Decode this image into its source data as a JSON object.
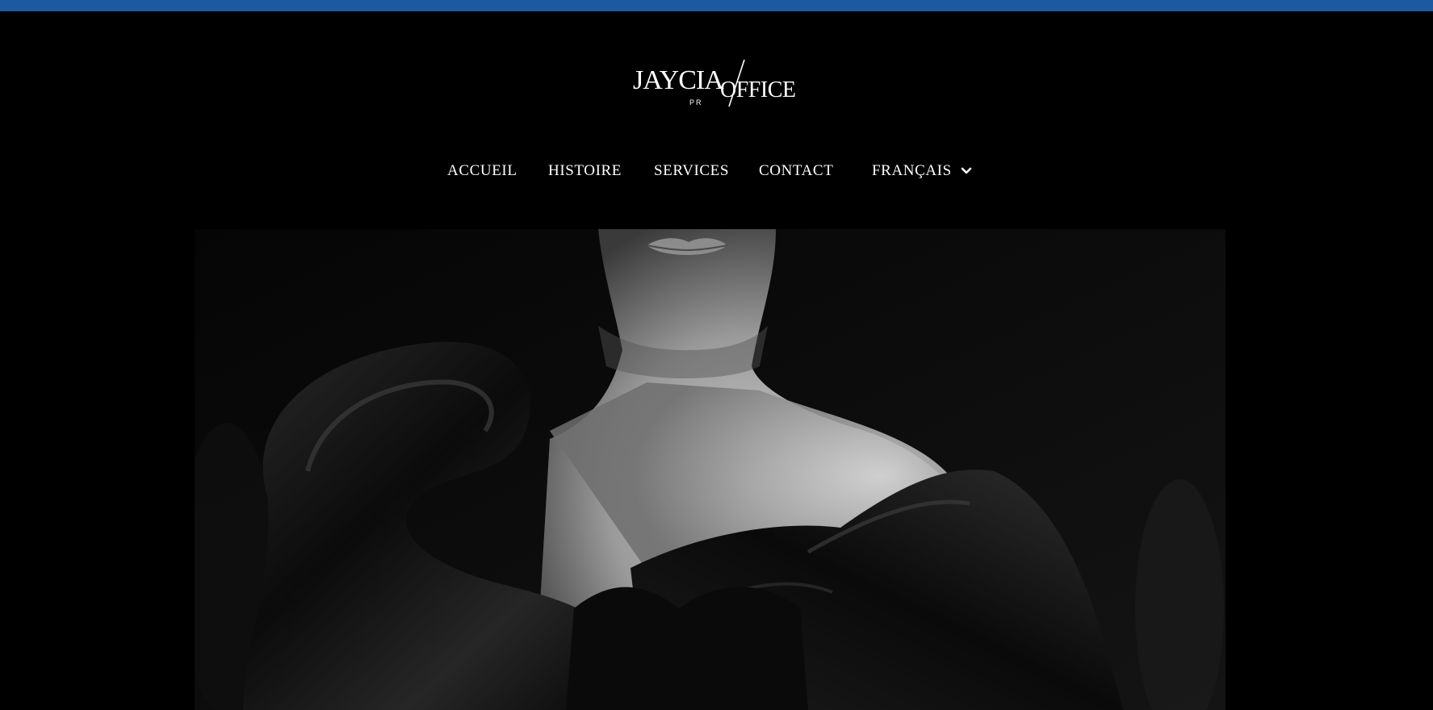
{
  "brand": {
    "logo_alt": "JayciaOffice PR",
    "logo_text_left": "JAYCIA",
    "logo_text_right": "OFFICE",
    "logo_sub": "PR"
  },
  "nav": {
    "items": [
      {
        "label": "ACCUEIL"
      },
      {
        "label": "HISTOIRE"
      },
      {
        "label": "SERVICES"
      },
      {
        "label": "CONTACT"
      }
    ],
    "language": {
      "selected": "FRANÇAIS",
      "icon": "chevron-down-icon"
    }
  },
  "hero": {
    "image_alt": "Portrait en noir et blanc d'un mannequin portant une robe de satin noir"
  },
  "colors": {
    "top_bar": "#1d59a1",
    "background": "#000000",
    "text": "#ffffff"
  }
}
